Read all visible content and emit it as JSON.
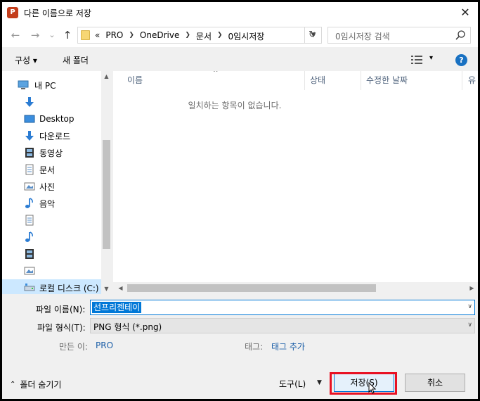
{
  "window": {
    "app_icon_letter": "P",
    "title": "다른 이름으로 저장",
    "close_glyph": "✕"
  },
  "navigation": {
    "back_glyph": "←",
    "forward_glyph": "→",
    "recent_glyph": "⌄",
    "up_glyph": "↑",
    "breadcrumbs": [
      "«",
      "PRO",
      "OneDrive",
      "문서",
      "0임시저장"
    ],
    "refresh_glyph": "↻",
    "search_placeholder": "0임시저장 검색"
  },
  "toolbar": {
    "organize_label": "구성 ▾",
    "new_folder_label": "새 폴더",
    "view_dropdown_glyph": "▾",
    "help_glyph": "?"
  },
  "sidebar": {
    "items": [
      {
        "label": "내 PC",
        "icon": "computer-icon"
      },
      {
        "label": "",
        "icon": "download-arrow-icon"
      },
      {
        "label": "Desktop",
        "icon": "desktop-icon"
      },
      {
        "label": "다운로드",
        "icon": "download-arrow-icon"
      },
      {
        "label": "동영상",
        "icon": "video-icon"
      },
      {
        "label": "문서",
        "icon": "document-icon"
      },
      {
        "label": "사진",
        "icon": "picture-icon"
      },
      {
        "label": "음악",
        "icon": "music-icon"
      },
      {
        "label": "",
        "icon": "document-icon"
      },
      {
        "label": "",
        "icon": "music-icon"
      },
      {
        "label": "",
        "icon": "video-icon"
      },
      {
        "label": "",
        "icon": "picture-icon"
      },
      {
        "label": "로컬 디스크 (C:)",
        "icon": "drive-icon"
      }
    ]
  },
  "file_list": {
    "columns": [
      "이름",
      "상태",
      "수정한 날짜",
      "유"
    ],
    "empty_message": "일치하는 항목이 없습니다."
  },
  "form": {
    "filename_label": "파일 이름(N):",
    "filename_value": "선프리젠테이",
    "filetype_label": "파일 형식(T):",
    "filetype_value": "PNG 형식 (*.png)",
    "author_label": "만든 이:",
    "author_value": "PRO",
    "tags_label": "태그:",
    "tags_value": "태그 추가"
  },
  "footer": {
    "hide_folders_label": "폴더 숨기기",
    "tools_label": "도구(L)",
    "save_label": "저장(S)",
    "cancel_label": "취소"
  },
  "colors": {
    "accent": "#0078d7",
    "highlight": "#e81123",
    "selected_row": "#cce8ff"
  }
}
